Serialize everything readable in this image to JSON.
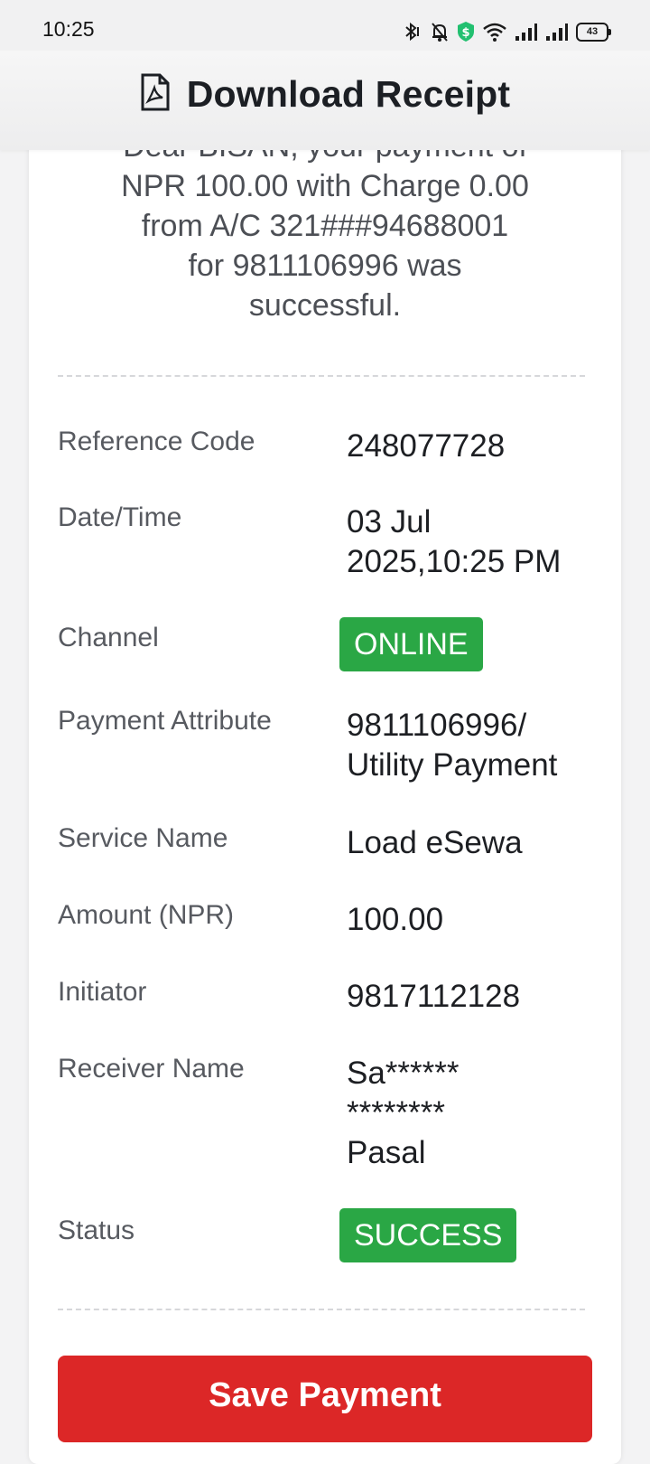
{
  "status_bar": {
    "time": "10:25",
    "battery": "43",
    "icons": [
      "bluetooth-icon",
      "bell-off-icon",
      "shield-dollar-icon",
      "wifi-icon",
      "signal-icon",
      "signal-icon",
      "battery-icon"
    ]
  },
  "header": {
    "title": "Download Receipt",
    "icon": "pdf-file-icon"
  },
  "message": {
    "line1": "Dear BISAN, your payment of",
    "line2": "NPR 100.00 with Charge 0.00",
    "line3": "from A/C 321###94688001",
    "line4": "for 9811106996 was",
    "line5": "successful."
  },
  "details": {
    "reference_code": {
      "label": "Reference Code",
      "value": "248077728"
    },
    "date_time": {
      "label": "Date/Time",
      "value_line1": "03 Jul",
      "value_line2": "2025,10:25 PM"
    },
    "channel": {
      "label": "Channel",
      "value": "ONLINE"
    },
    "payment_attribute": {
      "label": "Payment Attribute",
      "value_line1": "9811106996/",
      "value_line2": "Utility Payment"
    },
    "service_name": {
      "label": "Service Name",
      "value": "Load eSewa"
    },
    "amount": {
      "label": "Amount (NPR)",
      "value": "100.00"
    },
    "initiator": {
      "label": "Initiator",
      "value": "9817112128"
    },
    "receiver_name": {
      "label": "Receiver Name",
      "value_line1": "Sa******",
      "value_line2": "********",
      "value_line3": "Pasal"
    },
    "status": {
      "label": "Status",
      "value": "SUCCESS"
    }
  },
  "actions": {
    "save_label": "Save Payment"
  },
  "colors": {
    "badge_green": "#2aa745",
    "button_red": "#dc2727"
  }
}
